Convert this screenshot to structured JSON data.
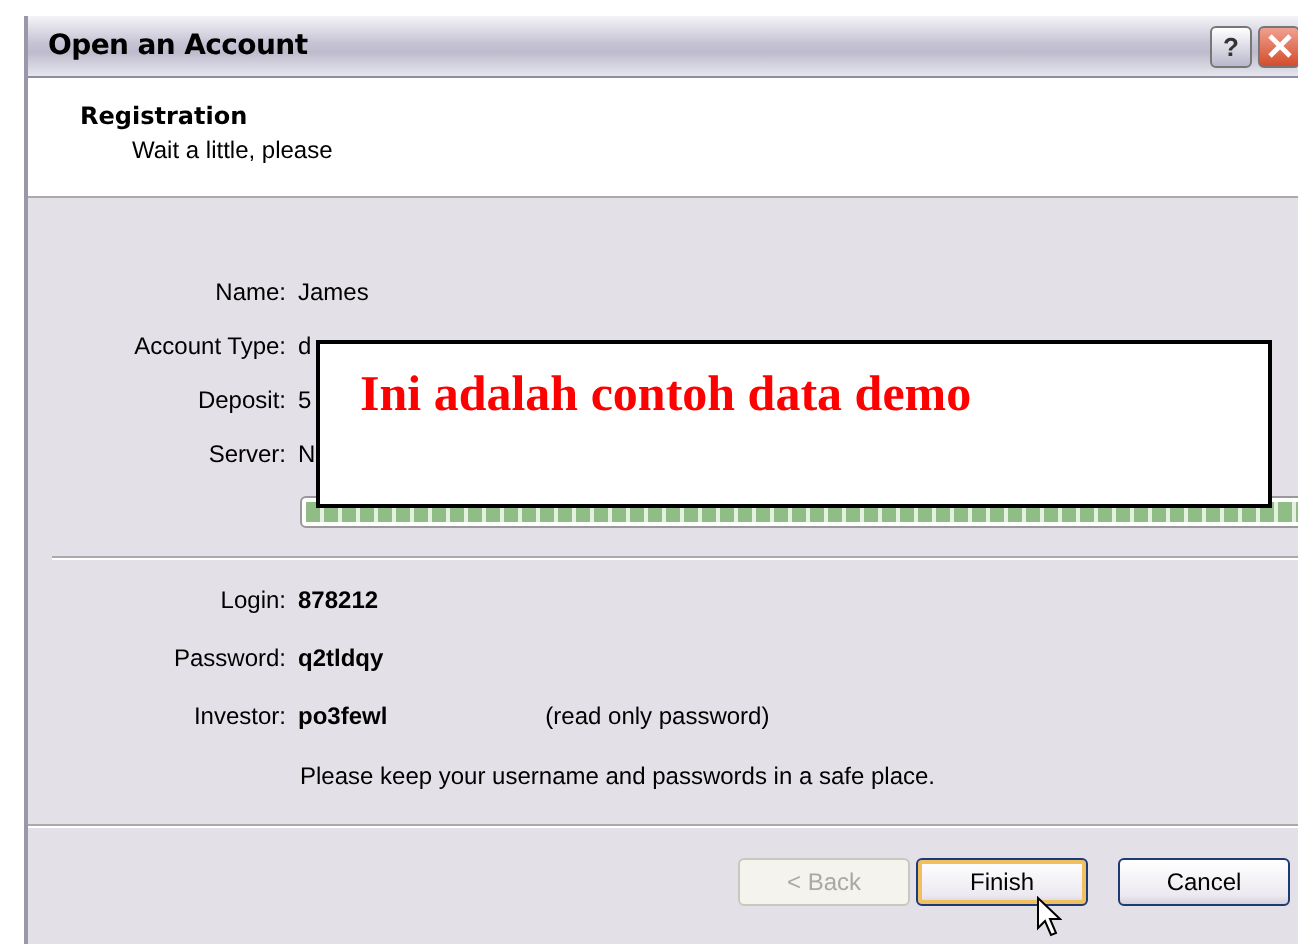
{
  "window": {
    "title": "Open an Account",
    "help_glyph": "?"
  },
  "header": {
    "title": "Registration",
    "subtitle": "Wait a little, please"
  },
  "account_fields": [
    {
      "label": "Name:",
      "value": "James"
    },
    {
      "label": "Account Type:",
      "value": "d"
    },
    {
      "label": "Deposit:",
      "value": "5"
    },
    {
      "label": "Server:",
      "value": "N"
    }
  ],
  "progress": {
    "level": 1
  },
  "overlay": {
    "text": "Ini adalah contoh data demo"
  },
  "credentials": [
    {
      "label": "Login:",
      "value": "878212"
    },
    {
      "label": "Password:",
      "value": "q2tldqy"
    },
    {
      "label": "Investor:",
      "value": "po3fewl",
      "note": "(read only password)"
    }
  ],
  "notice": "Please keep your username and passwords in a safe place.",
  "buttons": [
    {
      "label": "< Back",
      "disabled": true,
      "default": false
    },
    {
      "label": "Finish",
      "disabled": false,
      "default": true
    },
    {
      "label": "Cancel",
      "disabled": false,
      "default": false
    }
  ]
}
